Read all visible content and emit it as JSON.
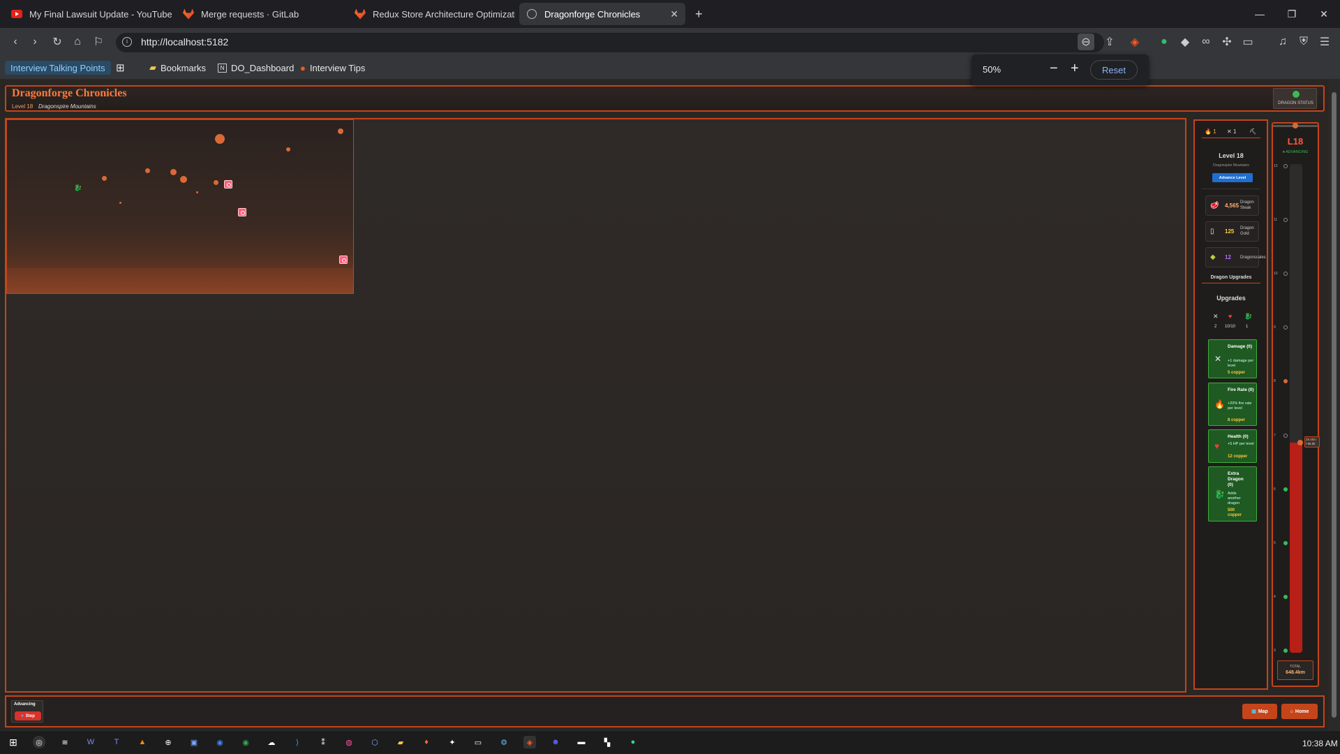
{
  "browser": {
    "tabs": [
      {
        "label": "My Final Lawsuit Update - YouTube",
        "icon": "youtube-icon"
      },
      {
        "label": "Merge requests · GitLab",
        "icon": "gitlab-icon"
      },
      {
        "label": "Redux Store Architecture Optimizatio",
        "icon": "gitlab-icon"
      },
      {
        "label": "Dragonforge Chronicles",
        "icon": "globe-icon",
        "active": true
      }
    ],
    "url": "http://localhost:5182",
    "bookmarks": {
      "active": "Interview Talking Points",
      "items": [
        "Bookmarks",
        "DO_Dashboard",
        "Interview Tips"
      ]
    },
    "zoom": {
      "value": "50%",
      "reset_label": "Reset"
    }
  },
  "game": {
    "title": "Dragonforge Chronicles",
    "level": "Level 18",
    "region": "Dragonspire Mountains",
    "dragon_status_label": "DRAGON STATUS",
    "panel": {
      "top_stats": [
        "1",
        "1"
      ],
      "level_heading": "Level 18",
      "region": "Dragonspire Mountains",
      "advance_button": "Advance Level",
      "resources": [
        {
          "icon": "meat-icon",
          "value": "4,565",
          "name": "Dragon Steak",
          "color": "#ffb070"
        },
        {
          "icon": "gold-icon",
          "value": "125",
          "name": "Dragon Gold",
          "color": "#ffd24a"
        },
        {
          "icon": "scale-icon",
          "value": "12",
          "name": "Dragonscales",
          "color": "#b070ff"
        }
      ],
      "upgrades_heading": "Dragon Upgrades",
      "upgrades_sub": "Upgrades",
      "upgrade_stats": [
        {
          "icon": "swords-icon",
          "value": "2"
        },
        {
          "icon": "heart-icon",
          "value": "10/10"
        },
        {
          "icon": "dragon-icon",
          "value": "1"
        }
      ],
      "upgrades": [
        {
          "icon": "swords-icon",
          "title": "Damage (0)",
          "desc": "+1 damage per level",
          "cost": "5 copper"
        },
        {
          "icon": "fire-icon",
          "title": "Fire Rate (0)",
          "desc": "+20% fire rate per level",
          "cost": "8 copper"
        },
        {
          "icon": "heart-icon",
          "title": "Health (0)",
          "desc": "+5 HP per level",
          "cost": "12 copper"
        },
        {
          "icon": "dragon-icon",
          "title": "Extra Dragon (0)",
          "desc": "Adds another dragon",
          "cost": "500 copper"
        }
      ]
    },
    "progress": {
      "level_badge": "L18",
      "status": "● ADVANCING",
      "fill_fraction": 0.43,
      "marker_label_top": "28.4km",
      "marker_label_bottom": "/ 66.0k",
      "total_label": "TOTAL",
      "total_value": "648.4km",
      "ticks": [
        "12",
        "11",
        "10",
        "9",
        "8",
        "7",
        "6",
        "5",
        "4",
        "3"
      ]
    },
    "bottom": {
      "status_text": "Advancing",
      "stop_label": "Stop",
      "map_label": "Map",
      "home_label": "Home"
    }
  },
  "taskbar": {
    "clock": "10:38 AM"
  }
}
